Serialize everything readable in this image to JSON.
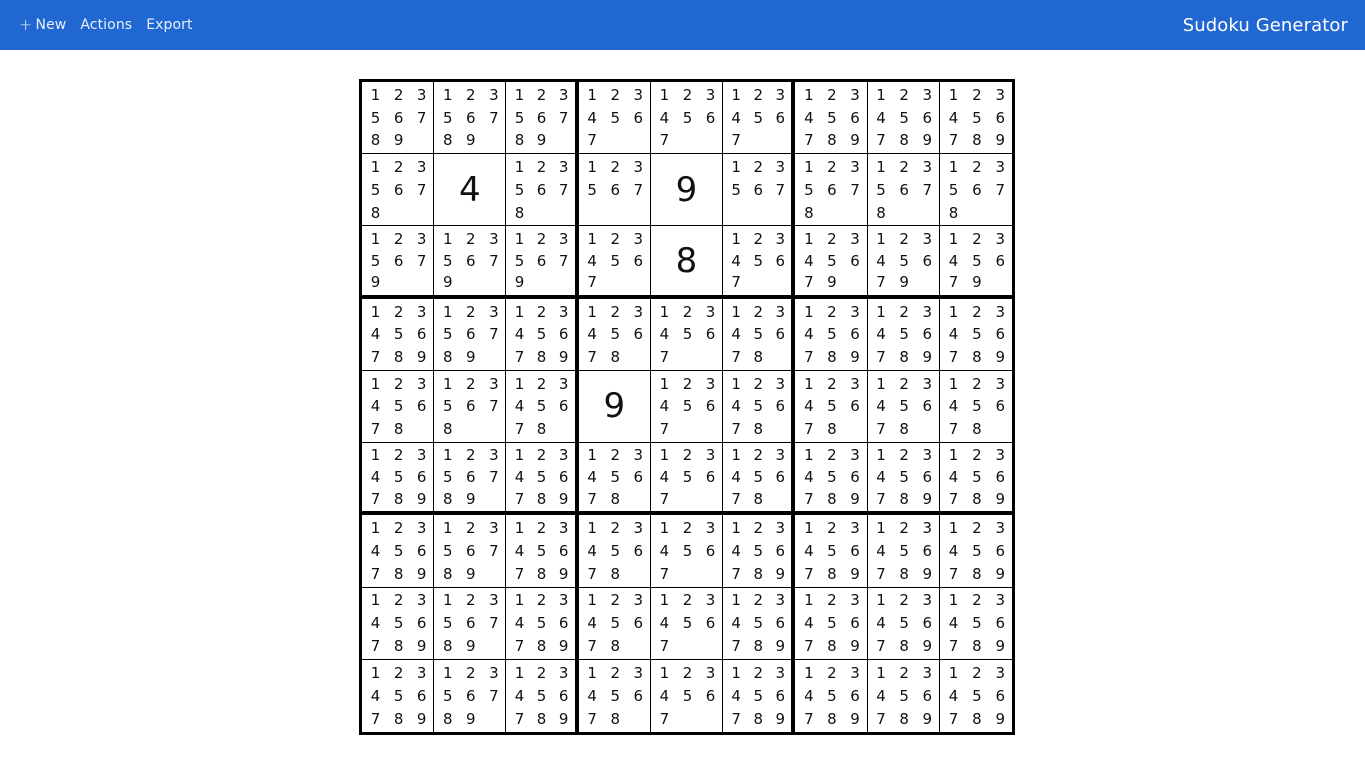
{
  "menu": [
    {
      "label": "New",
      "icon": "plus-icon"
    },
    {
      "label": "Actions"
    },
    {
      "label": "Export"
    }
  ],
  "app_title": "Sudoku Generator",
  "board": [
    [
      [
        "1",
        "2",
        "3",
        "5",
        "6",
        "7",
        "8",
        "9"
      ],
      [
        "1",
        "2",
        "3",
        "5",
        "6",
        "7",
        "8",
        "9"
      ],
      [
        "1",
        "2",
        "3",
        "5",
        "6",
        "7",
        "8",
        "9"
      ],
      [
        "1",
        "2",
        "3",
        "4",
        "5",
        "6",
        "7"
      ],
      [
        "1",
        "2",
        "3",
        "4",
        "5",
        "6",
        "7"
      ],
      [
        "1",
        "2",
        "3",
        "4",
        "5",
        "6",
        "7"
      ],
      [
        "1",
        "2",
        "3",
        "4",
        "5",
        "6",
        "7",
        "8",
        "9"
      ],
      [
        "1",
        "2",
        "3",
        "4",
        "5",
        "6",
        "7",
        "8",
        "9"
      ],
      [
        "1",
        "2",
        "3",
        "4",
        "5",
        "6",
        "7",
        "8",
        "9"
      ]
    ],
    [
      [
        "1",
        "2",
        "3",
        "5",
        "6",
        "7",
        "8"
      ],
      "4",
      [
        "1",
        "2",
        "3",
        "5",
        "6",
        "7",
        "8"
      ],
      [
        "1",
        "2",
        "3",
        "5",
        "6",
        "7"
      ],
      "9",
      [
        "1",
        "2",
        "3",
        "5",
        "6",
        "7"
      ],
      [
        "1",
        "2",
        "3",
        "5",
        "6",
        "7",
        "8"
      ],
      [
        "1",
        "2",
        "3",
        "5",
        "6",
        "7",
        "8"
      ],
      [
        "1",
        "2",
        "3",
        "5",
        "6",
        "7",
        "8"
      ]
    ],
    [
      [
        "1",
        "2",
        "3",
        "5",
        "6",
        "7",
        "9"
      ],
      [
        "1",
        "2",
        "3",
        "5",
        "6",
        "7",
        "9"
      ],
      [
        "1",
        "2",
        "3",
        "5",
        "6",
        "7",
        "9"
      ],
      [
        "1",
        "2",
        "3",
        "4",
        "5",
        "6",
        "7"
      ],
      "8",
      [
        "1",
        "2",
        "3",
        "4",
        "5",
        "6",
        "7"
      ],
      [
        "1",
        "2",
        "3",
        "4",
        "5",
        "6",
        "7",
        "9"
      ],
      [
        "1",
        "2",
        "3",
        "4",
        "5",
        "6",
        "7",
        "9"
      ],
      [
        "1",
        "2",
        "3",
        "4",
        "5",
        "6",
        "7",
        "9"
      ]
    ],
    [
      [
        "1",
        "2",
        "3",
        "4",
        "5",
        "6",
        "7",
        "8",
        "9"
      ],
      [
        "1",
        "2",
        "3",
        "5",
        "6",
        "7",
        "8",
        "9"
      ],
      [
        "1",
        "2",
        "3",
        "4",
        "5",
        "6",
        "7",
        "8",
        "9"
      ],
      [
        "1",
        "2",
        "3",
        "4",
        "5",
        "6",
        "7",
        "8"
      ],
      [
        "1",
        "2",
        "3",
        "4",
        "5",
        "6",
        "7"
      ],
      [
        "1",
        "2",
        "3",
        "4",
        "5",
        "6",
        "7",
        "8"
      ],
      [
        "1",
        "2",
        "3",
        "4",
        "5",
        "6",
        "7",
        "8",
        "9"
      ],
      [
        "1",
        "2",
        "3",
        "4",
        "5",
        "6",
        "7",
        "8",
        "9"
      ],
      [
        "1",
        "2",
        "3",
        "4",
        "5",
        "6",
        "7",
        "8",
        "9"
      ]
    ],
    [
      [
        "1",
        "2",
        "3",
        "4",
        "5",
        "6",
        "7",
        "8"
      ],
      [
        "1",
        "2",
        "3",
        "5",
        "6",
        "7",
        "8"
      ],
      [
        "1",
        "2",
        "3",
        "4",
        "5",
        "6",
        "7",
        "8"
      ],
      "9",
      [
        "1",
        "2",
        "3",
        "4",
        "5",
        "6",
        "7"
      ],
      [
        "1",
        "2",
        "3",
        "4",
        "5",
        "6",
        "7",
        "8"
      ],
      [
        "1",
        "2",
        "3",
        "4",
        "5",
        "6",
        "7",
        "8"
      ],
      [
        "1",
        "2",
        "3",
        "4",
        "5",
        "6",
        "7",
        "8"
      ],
      [
        "1",
        "2",
        "3",
        "4",
        "5",
        "6",
        "7",
        "8"
      ]
    ],
    [
      [
        "1",
        "2",
        "3",
        "4",
        "5",
        "6",
        "7",
        "8",
        "9"
      ],
      [
        "1",
        "2",
        "3",
        "5",
        "6",
        "7",
        "8",
        "9"
      ],
      [
        "1",
        "2",
        "3",
        "4",
        "5",
        "6",
        "7",
        "8",
        "9"
      ],
      [
        "1",
        "2",
        "3",
        "4",
        "5",
        "6",
        "7",
        "8"
      ],
      [
        "1",
        "2",
        "3",
        "4",
        "5",
        "6",
        "7"
      ],
      [
        "1",
        "2",
        "3",
        "4",
        "5",
        "6",
        "7",
        "8"
      ],
      [
        "1",
        "2",
        "3",
        "4",
        "5",
        "6",
        "7",
        "8",
        "9"
      ],
      [
        "1",
        "2",
        "3",
        "4",
        "5",
        "6",
        "7",
        "8",
        "9"
      ],
      [
        "1",
        "2",
        "3",
        "4",
        "5",
        "6",
        "7",
        "8",
        "9"
      ]
    ],
    [
      [
        "1",
        "2",
        "3",
        "4",
        "5",
        "6",
        "7",
        "8",
        "9"
      ],
      [
        "1",
        "2",
        "3",
        "5",
        "6",
        "7",
        "8",
        "9"
      ],
      [
        "1",
        "2",
        "3",
        "4",
        "5",
        "6",
        "7",
        "8",
        "9"
      ],
      [
        "1",
        "2",
        "3",
        "4",
        "5",
        "6",
        "7",
        "8"
      ],
      [
        "1",
        "2",
        "3",
        "4",
        "5",
        "6",
        "7"
      ],
      [
        "1",
        "2",
        "3",
        "4",
        "5",
        "6",
        "7",
        "8",
        "9"
      ],
      [
        "1",
        "2",
        "3",
        "4",
        "5",
        "6",
        "7",
        "8",
        "9"
      ],
      [
        "1",
        "2",
        "3",
        "4",
        "5",
        "6",
        "7",
        "8",
        "9"
      ],
      [
        "1",
        "2",
        "3",
        "4",
        "5",
        "6",
        "7",
        "8",
        "9"
      ]
    ],
    [
      [
        "1",
        "2",
        "3",
        "4",
        "5",
        "6",
        "7",
        "8",
        "9"
      ],
      [
        "1",
        "2",
        "3",
        "5",
        "6",
        "7",
        "8",
        "9"
      ],
      [
        "1",
        "2",
        "3",
        "4",
        "5",
        "6",
        "7",
        "8",
        "9"
      ],
      [
        "1",
        "2",
        "3",
        "4",
        "5",
        "6",
        "7",
        "8"
      ],
      [
        "1",
        "2",
        "3",
        "4",
        "5",
        "6",
        "7"
      ],
      [
        "1",
        "2",
        "3",
        "4",
        "5",
        "6",
        "7",
        "8",
        "9"
      ],
      [
        "1",
        "2",
        "3",
        "4",
        "5",
        "6",
        "7",
        "8",
        "9"
      ],
      [
        "1",
        "2",
        "3",
        "4",
        "5",
        "6",
        "7",
        "8",
        "9"
      ],
      [
        "1",
        "2",
        "3",
        "4",
        "5",
        "6",
        "7",
        "8",
        "9"
      ]
    ],
    [
      [
        "1",
        "2",
        "3",
        "4",
        "5",
        "6",
        "7",
        "8",
        "9"
      ],
      [
        "1",
        "2",
        "3",
        "5",
        "6",
        "7",
        "8",
        "9"
      ],
      [
        "1",
        "2",
        "3",
        "4",
        "5",
        "6",
        "7",
        "8",
        "9"
      ],
      [
        "1",
        "2",
        "3",
        "4",
        "5",
        "6",
        "7",
        "8"
      ],
      [
        "1",
        "2",
        "3",
        "4",
        "5",
        "6",
        "7"
      ],
      [
        "1",
        "2",
        "3",
        "4",
        "5",
        "6",
        "7",
        "8",
        "9"
      ],
      [
        "1",
        "2",
        "3",
        "4",
        "5",
        "6",
        "7",
        "8",
        "9"
      ],
      [
        "1",
        "2",
        "3",
        "4",
        "5",
        "6",
        "7",
        "8",
        "9"
      ],
      [
        "1",
        "2",
        "3",
        "4",
        "5",
        "6",
        "7",
        "8",
        "9"
      ]
    ]
  ]
}
